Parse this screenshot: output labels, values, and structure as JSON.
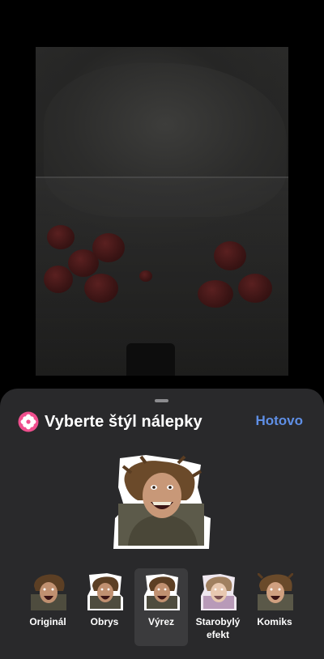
{
  "sheet": {
    "title": "Vyberte štýl nálepky",
    "done_label": "Hotovo",
    "accent_color": "#5f8fe6"
  },
  "icons": {
    "header_icon": "flower-icon"
  },
  "styles": [
    {
      "label": "Originál",
      "selected": false
    },
    {
      "label": "Obrys",
      "selected": false
    },
    {
      "label": "Výrez",
      "selected": true
    },
    {
      "label": "Starobylý efekt",
      "selected": false
    },
    {
      "label": "Komiks",
      "selected": false
    }
  ]
}
